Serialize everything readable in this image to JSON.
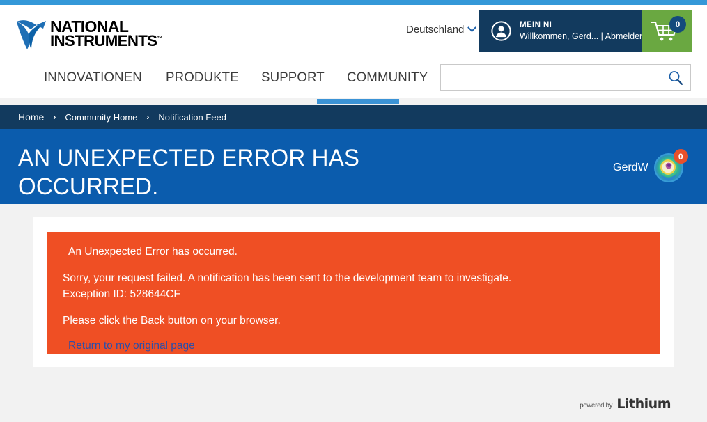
{
  "colors": {
    "top_strip": "#3498d8",
    "header_bg": "#ffffff",
    "mein_ni_bg": "#123a5e",
    "cart_bg": "#6aa841",
    "cart_badge_bg": "#134a7c",
    "nav_underline": "#3b93d6",
    "breadcrumb_bg": "#123a5e",
    "hero_bg": "#0b5cad",
    "page_bg": "#f2f2f2",
    "card_bg": "#ffffff",
    "error_bg": "#ef4f24",
    "error_link": "#2d4ea8",
    "avatar_badge_bg": "#e8502a"
  },
  "header": {
    "logo": {
      "line1": "NATIONAL",
      "line2": "INSTRUMENTS",
      "trademark": "™",
      "icon": "ni-eagle-logo"
    },
    "country": {
      "label": "Deutschland",
      "icon": "chevron-down-icon"
    },
    "account": {
      "icon": "user-circle-icon",
      "title": "MEIN NI",
      "subtitle": "Willkommen, Gerd... | Abmelden"
    },
    "cart": {
      "icon": "shopping-cart-icon",
      "count": "0"
    },
    "search": {
      "value": "",
      "placeholder": "",
      "icon": "search-icon"
    }
  },
  "nav": {
    "items": [
      {
        "label": "INNOVATIONEN",
        "active": false
      },
      {
        "label": "PRODUKTE",
        "active": false
      },
      {
        "label": "SUPPORT",
        "active": false
      },
      {
        "label": "COMMUNITY",
        "active": true
      }
    ]
  },
  "breadcrumb": {
    "separator": "›",
    "items": [
      {
        "label": "Home"
      },
      {
        "label": "Community Home"
      },
      {
        "label": "Notification Feed"
      }
    ]
  },
  "hero": {
    "title": "AN UNEXPECTED ERROR HAS OCCURRED.",
    "user": {
      "name": "GerdW",
      "avatar_icon": "user-avatar-colorful",
      "notification_count": "0"
    }
  },
  "error": {
    "heading": "An Unexpected Error has occurred.",
    "body_line1": "Sorry, your request failed. A notification has been sent to the development team to investigate.",
    "body_line2": "Exception ID: 528644CF",
    "note": "Please click the Back button on your browser.",
    "link_label": "Return to my original page"
  },
  "footer": {
    "powered_by": "powered by",
    "brand": "Lithium"
  }
}
